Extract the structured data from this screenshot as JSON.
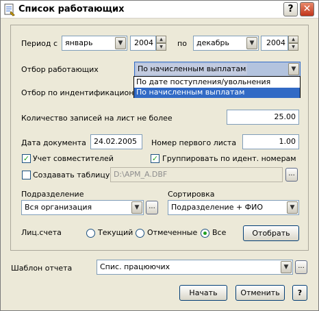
{
  "window": {
    "title": "Список работающих",
    "help_btn": "?",
    "close_btn": "✕"
  },
  "period": {
    "label_from": "Период с",
    "month_from": "январь",
    "year_from": "2004",
    "label_to": "по",
    "month_to": "декабрь",
    "year_to": "2004"
  },
  "filter": {
    "label": "Отбор работающих",
    "value": "По начисленным выплатам",
    "options": [
      "По дате поступления/увольнения",
      "По начисленным выплатам"
    ],
    "selected_index": 1
  },
  "id_filter": {
    "label": "Отбор по индентификационным"
  },
  "records": {
    "label": "Количество записей на лист не более",
    "value": "25.00"
  },
  "doc_date": {
    "label": "Дата документа",
    "value": "24.02.2005"
  },
  "first_sheet": {
    "label": "Номер первого листа",
    "value": "1.00"
  },
  "checkboxes": {
    "combined": {
      "label": "Учет совместителей",
      "checked": true
    },
    "group_id": {
      "label": "Группировать по идент. номерам",
      "checked": true
    },
    "create_table": {
      "label": "Создавать таблицу",
      "checked": false
    }
  },
  "table_path": {
    "value": "D:\\APM_A.DBF",
    "browse": "..."
  },
  "division": {
    "label": "Подразделение",
    "value": "Вся организация",
    "browse": "..."
  },
  "sorting": {
    "label": "Сортировка",
    "value": "Подразделение + ФИО"
  },
  "accounts": {
    "label": "Лиц.счета",
    "options": [
      {
        "label": "Текущий",
        "selected": false
      },
      {
        "label": "Отмеченные",
        "selected": false
      },
      {
        "label": "Все",
        "selected": true
      }
    ],
    "select_button": "Отобрать"
  },
  "template": {
    "label": "Шаблон отчета",
    "value": "Спис. працюючих",
    "browse": "..."
  },
  "footer": {
    "start": "Начать",
    "cancel": "Отменить",
    "help": "?"
  },
  "colors": {
    "accent": "#316ac5",
    "check": "#21a121",
    "window_bg": "#ece9d8"
  }
}
